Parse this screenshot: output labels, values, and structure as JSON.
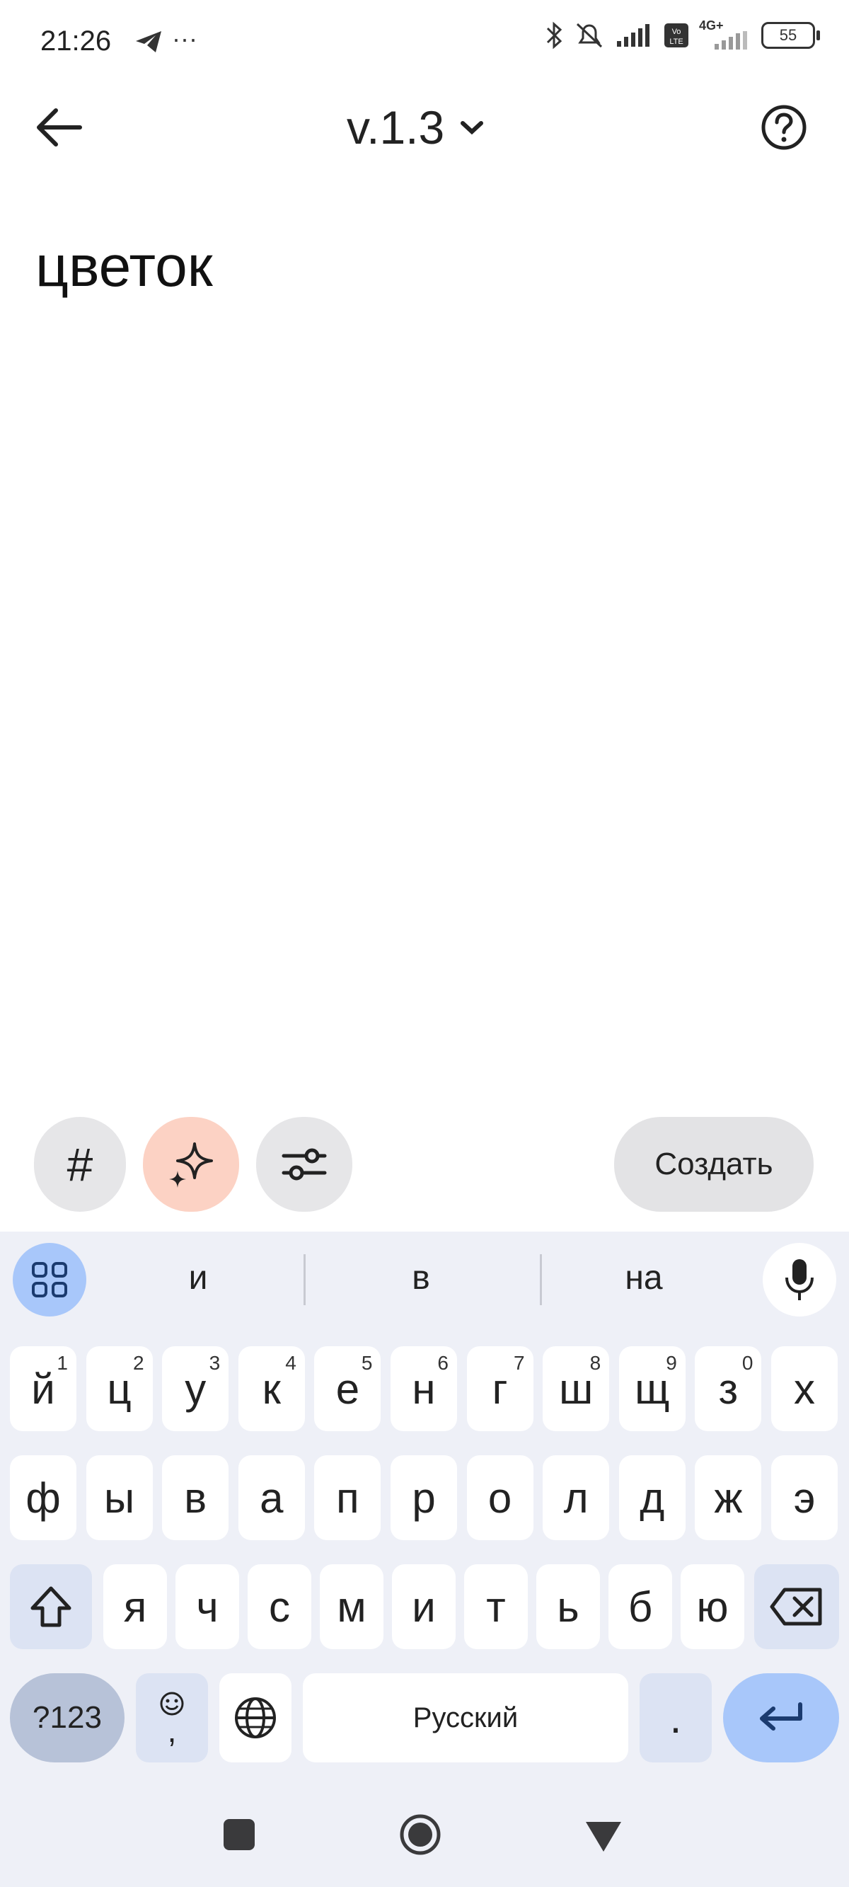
{
  "status_bar": {
    "time": "21:26",
    "battery": "55",
    "network": "4G+"
  },
  "app_bar": {
    "version_label": "v.1.3"
  },
  "editor": {
    "text": "цветок"
  },
  "actions": {
    "hash_label": "#",
    "create_label": "Создать"
  },
  "keyboard": {
    "suggestions": [
      "и",
      "в",
      "на"
    ],
    "row1": [
      {
        "char": "й",
        "hint": "1"
      },
      {
        "char": "ц",
        "hint": "2"
      },
      {
        "char": "у",
        "hint": "3"
      },
      {
        "char": "к",
        "hint": "4"
      },
      {
        "char": "е",
        "hint": "5"
      },
      {
        "char": "н",
        "hint": "6"
      },
      {
        "char": "г",
        "hint": "7"
      },
      {
        "char": "ш",
        "hint": "8"
      },
      {
        "char": "щ",
        "hint": "9"
      },
      {
        "char": "з",
        "hint": "0"
      },
      {
        "char": "х",
        "hint": ""
      }
    ],
    "row2": [
      "ф",
      "ы",
      "в",
      "а",
      "п",
      "р",
      "о",
      "л",
      "д",
      "ж",
      "э"
    ],
    "row3": [
      "я",
      "ч",
      "с",
      "м",
      "и",
      "т",
      "ь",
      "б",
      "ю"
    ],
    "symbols_label": "?123",
    "comma_label": ",",
    "space_label": "Русский",
    "period_label": "."
  },
  "colors": {
    "keyboard_bg": "#eef0f7",
    "ai_chip": "#fcd2c4",
    "accent": "#a8c7fa"
  }
}
